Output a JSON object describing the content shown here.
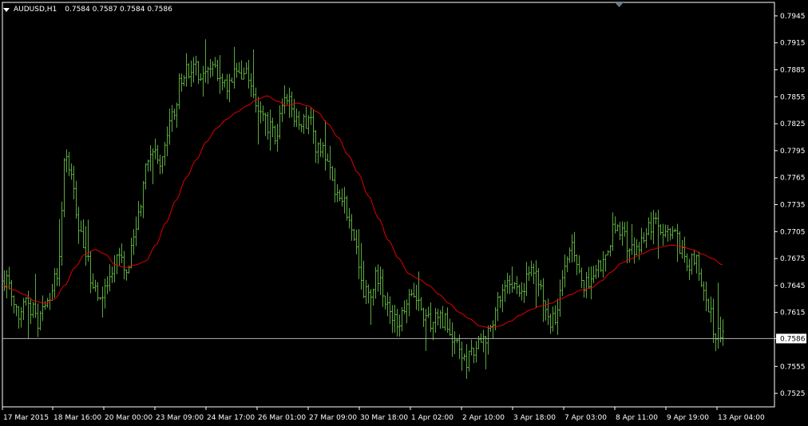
{
  "header": {
    "symbol": "AUDUSD,H1",
    "ohlc": "0.7584 0.7587 0.7584 0.7586"
  },
  "colors": {
    "background": "#000000",
    "bars": "#5aa83c",
    "moving_average": "#e00000",
    "axis": "#ffffff",
    "bid_line": "#b0b0b0",
    "bid_label_bg": "#ffffff",
    "bid_label_text": "#000000"
  },
  "icons": {
    "header": "dropdown-triangle-icon",
    "shift_marker": "shift-triangle-icon"
  },
  "chart_data": {
    "type": "ohlc-bars",
    "timeframe": "H1",
    "ylim": [
      0.751,
      0.796
    ],
    "y_ticks": [
      "0.7945",
      "0.7915",
      "0.7885",
      "0.7855",
      "0.7825",
      "0.7795",
      "0.7765",
      "0.7735",
      "0.7705",
      "0.7675",
      "0.7645",
      "0.7615",
      "0.7586",
      "0.7555",
      "0.7525"
    ],
    "x_ticks": [
      "17 Mar 2015",
      "18 Mar 16:00",
      "20 Mar 00:00",
      "23 Mar 09:00",
      "24 Mar 17:00",
      "26 Mar 01:00",
      "27 Mar 09:00",
      "30 Mar 18:00",
      "1 Apr 02:00",
      "2 Apr 10:00",
      "3 Apr 18:00",
      "7 Apr 03:00",
      "8 Apr 11:00",
      "9 Apr 19:00",
      "13 Apr 04:00"
    ],
    "current_price": "0.7586",
    "price_path": [
      0.765,
      0.764,
      0.7615,
      0.7632,
      0.762,
      0.7605,
      0.7625,
      0.764,
      0.7665,
      0.779,
      0.776,
      0.771,
      0.768,
      0.765,
      0.7635,
      0.7645,
      0.766,
      0.768,
      0.7665,
      0.769,
      0.7725,
      0.7785,
      0.779,
      0.7775,
      0.7815,
      0.784,
      0.787,
      0.7885,
      0.789,
      0.7875,
      0.788,
      0.789,
      0.7875,
      0.787,
      0.788,
      0.7878,
      0.788,
      0.785,
      0.784,
      0.782,
      0.781,
      0.785,
      0.786,
      0.783,
      0.7825,
      0.783,
      0.78,
      0.7795,
      0.778,
      0.7745,
      0.7735,
      0.7715,
      0.768,
      0.764,
      0.764,
      0.7655,
      0.7635,
      0.7615,
      0.76,
      0.7615,
      0.764,
      0.763,
      0.761,
      0.76,
      0.761,
      0.7605,
      0.759,
      0.758,
      0.756,
      0.757,
      0.7585,
      0.759,
      0.76,
      0.763,
      0.765,
      0.764,
      0.7635,
      0.765,
      0.766,
      0.764,
      0.761,
      0.7605,
      0.7635,
      0.768,
      0.7685,
      0.765,
      0.7645,
      0.765,
      0.767,
      0.7685,
      0.771,
      0.7705,
      0.769,
      0.768,
      0.769,
      0.771,
      0.772,
      0.7705,
      0.77,
      0.771,
      0.768,
      0.767,
      0.7675,
      0.765,
      0.7615,
      0.759,
      0.7586
    ],
    "moving_average": [
      0.7645,
      0.764,
      0.7635,
      0.7628,
      0.7625,
      0.763,
      0.7645,
      0.7665,
      0.768,
      0.7685,
      0.768,
      0.7668,
      0.7665,
      0.7668,
      0.7672,
      0.769,
      0.7715,
      0.774,
      0.7765,
      0.7785,
      0.7805,
      0.782,
      0.783,
      0.7838,
      0.7845,
      0.7852,
      0.7856,
      0.785,
      0.7845,
      0.7848,
      0.7845,
      0.7838,
      0.7825,
      0.781,
      0.779,
      0.777,
      0.7745,
      0.772,
      0.7695,
      0.7675,
      0.7658,
      0.7652,
      0.7645,
      0.7635,
      0.7625,
      0.7615,
      0.7608,
      0.76,
      0.7598,
      0.76,
      0.7605,
      0.7612,
      0.7618,
      0.7622,
      0.7625,
      0.763,
      0.7635,
      0.764,
      0.7642,
      0.765,
      0.766,
      0.767,
      0.7675,
      0.768,
      0.7685,
      0.7688,
      0.769,
      0.7688,
      0.7685,
      0.768,
      0.7675,
      0.7668
    ]
  }
}
